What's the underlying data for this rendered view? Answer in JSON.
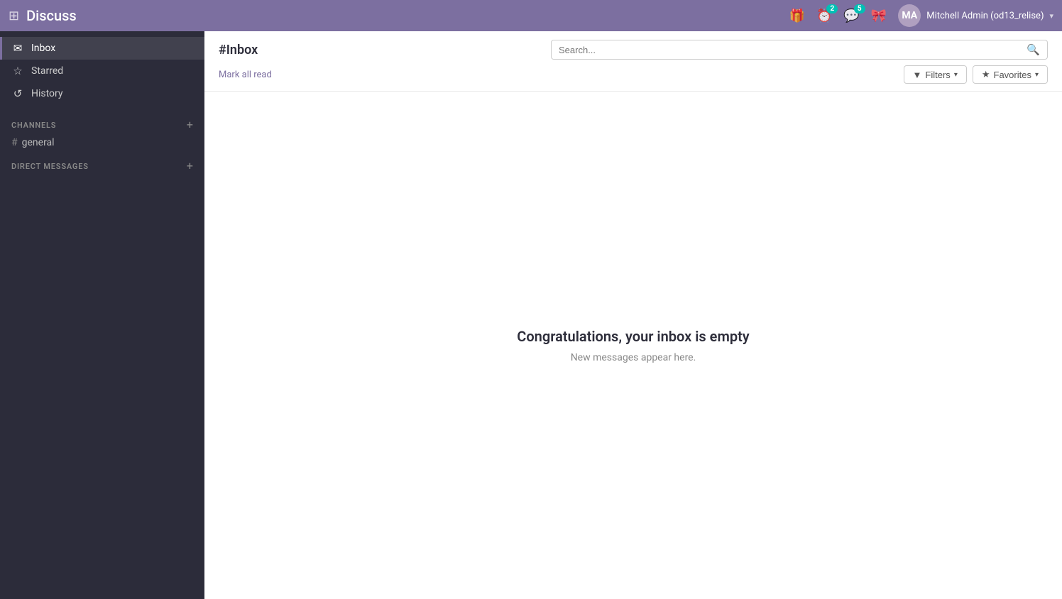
{
  "navbar": {
    "app_title": "Discuss",
    "grid_icon": "⊞",
    "icons": [
      {
        "name": "gift-icon",
        "symbol": "🎁",
        "badge": null
      },
      {
        "name": "clock-icon",
        "symbol": "⏰",
        "badge": "2",
        "badge_color": "teal"
      },
      {
        "name": "chat-icon",
        "symbol": "💬",
        "badge": "5",
        "badge_color": "teal"
      },
      {
        "name": "present-icon",
        "symbol": "🎀",
        "badge": null
      }
    ],
    "user": {
      "name": "Mitchell Admin (od13_relise)",
      "avatar_initials": "MA"
    },
    "chevron": "▾"
  },
  "content_header": {
    "title": "#Inbox",
    "mark_all_read": "Mark all read",
    "search_placeholder": "Search...",
    "filters_label": "Filters",
    "favorites_label": "Favorites"
  },
  "sidebar": {
    "nav_items": [
      {
        "id": "inbox",
        "label": "Inbox",
        "icon": "✉",
        "active": true
      },
      {
        "id": "starred",
        "label": "Starred",
        "icon": "☆",
        "active": false
      },
      {
        "id": "history",
        "label": "History",
        "icon": "↺",
        "active": false
      }
    ],
    "channels_section": {
      "label": "CHANNELS",
      "add_label": "+",
      "items": [
        {
          "id": "general",
          "label": "general"
        }
      ]
    },
    "direct_messages_section": {
      "label": "DIRECT MESSAGES",
      "add_label": "+"
    }
  },
  "main_content": {
    "empty_title": "Congratulations, your inbox is empty",
    "empty_subtitle": "New messages appear here."
  }
}
